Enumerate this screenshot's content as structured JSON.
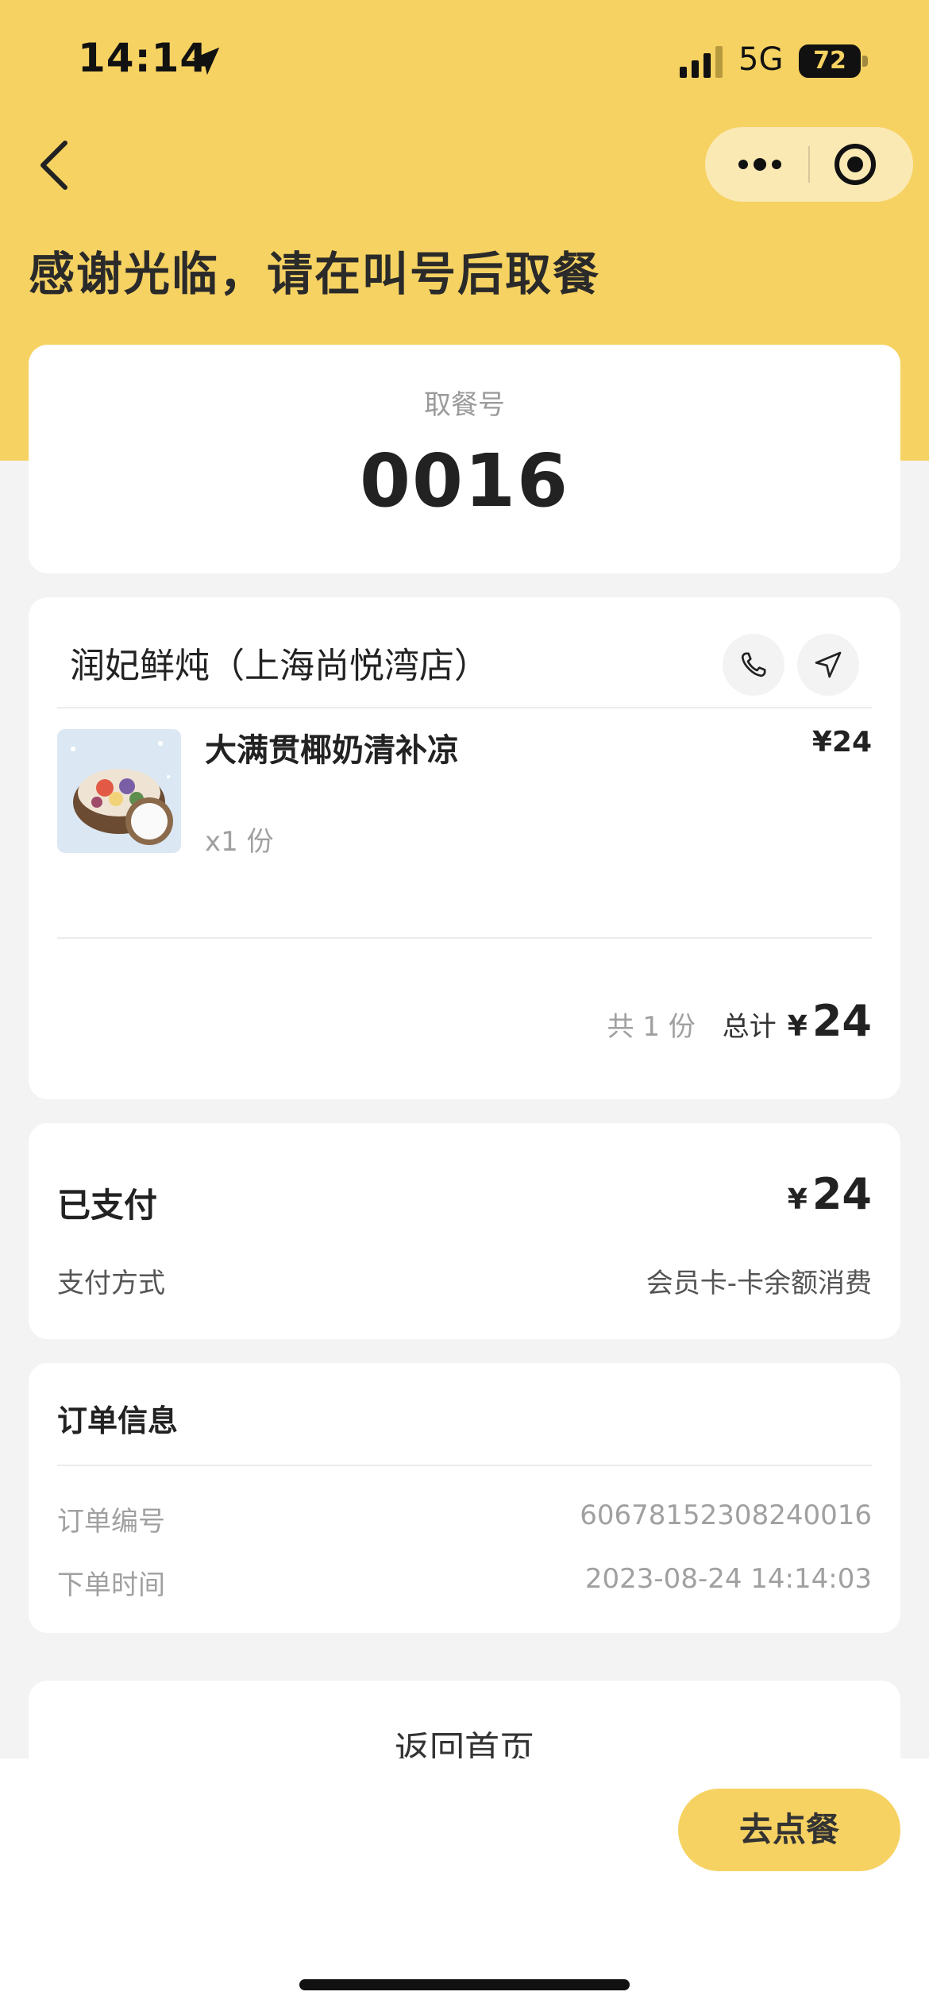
{
  "status_bar": {
    "time": "14:14",
    "network": "5G",
    "battery_percent": 72,
    "battery_text": "72"
  },
  "nav": {
    "back_icon": "chevron-left-icon",
    "more_icon": "more-dots-icon",
    "close_icon": "target-circle-icon"
  },
  "page": {
    "title": "感谢光临，请在叫号后取餐"
  },
  "pickup": {
    "label": "取餐号",
    "number": "0016"
  },
  "order": {
    "store_name": "润妃鲜炖（上海尚悦湾店）",
    "phone_icon": "phone-icon",
    "navigate_icon": "navigation-arrow-icon",
    "items": [
      {
        "name": "大满贯椰奶清补凉",
        "price": "¥24",
        "quantity": "x1 份",
        "image": "coconut-dessert-illustration"
      }
    ],
    "total_count": "共 1 份",
    "total_label": "总计",
    "total_currency": "¥",
    "total_amount": "24"
  },
  "payment": {
    "status": "已支付",
    "currency": "¥",
    "amount": "24",
    "method_label": "支付方式",
    "method_value": "会员卡-卡余额消费"
  },
  "order_info": {
    "title": "订单信息",
    "rows": [
      {
        "label": "订单编号",
        "value": "60678152308240016"
      },
      {
        "label": "下单时间",
        "value": "2023-08-24 14:14:03"
      }
    ]
  },
  "actions": {
    "home_label": "返回首页",
    "order_label": "去点餐"
  },
  "colors": {
    "brand_yellow": "#f6d262",
    "background": "#f3f3f3",
    "text_primary": "#222222",
    "text_secondary": "#a0a0a0"
  }
}
